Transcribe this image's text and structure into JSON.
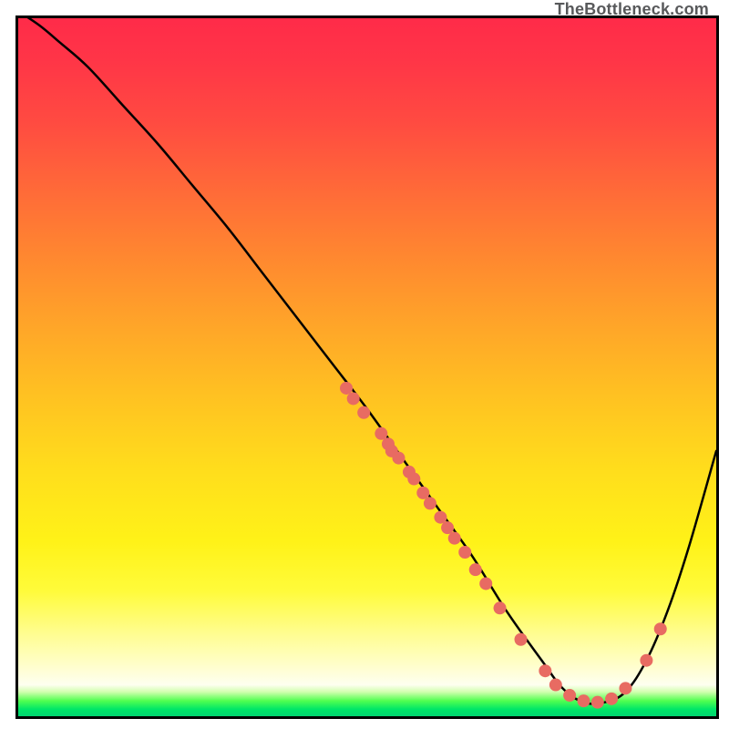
{
  "watermark": "TheBottleneck.com",
  "chart_data": {
    "type": "line",
    "title": "",
    "xlabel": "",
    "ylabel": "",
    "xlim": [
      0,
      100
    ],
    "ylim": [
      0,
      100
    ],
    "gradient_stops": [
      {
        "offset": 0.0,
        "color": "#ff2b49"
      },
      {
        "offset": 0.06,
        "color": "#ff3547"
      },
      {
        "offset": 0.15,
        "color": "#ff4b41"
      },
      {
        "offset": 0.25,
        "color": "#ff6b38"
      },
      {
        "offset": 0.35,
        "color": "#ff8a2f"
      },
      {
        "offset": 0.45,
        "color": "#ffa828"
      },
      {
        "offset": 0.55,
        "color": "#ffc421"
      },
      {
        "offset": 0.65,
        "color": "#ffde1c"
      },
      {
        "offset": 0.75,
        "color": "#fff218"
      },
      {
        "offset": 0.82,
        "color": "#fffb3a"
      },
      {
        "offset": 0.88,
        "color": "#fffd8e"
      },
      {
        "offset": 0.93,
        "color": "#fffecf"
      },
      {
        "offset": 0.955,
        "color": "#fefff0"
      },
      {
        "offset": 0.965,
        "color": "#d2ffb0"
      },
      {
        "offset": 0.978,
        "color": "#50ff50"
      },
      {
        "offset": 0.99,
        "color": "#00e668"
      },
      {
        "offset": 1.0,
        "color": "#00d570"
      }
    ],
    "series": [
      {
        "name": "curve",
        "x": [
          0.0,
          3.0,
          6.0,
          10.0,
          15.0,
          20.0,
          25.0,
          30.0,
          35.0,
          40.0,
          45.0,
          50.0,
          55.0,
          60.0,
          65.0,
          70.0,
          75.0,
          78.0,
          81.0,
          84.0,
          87.0,
          90.0,
          93.0,
          96.0,
          100.0
        ],
        "y": [
          101.0,
          99.0,
          96.5,
          93.0,
          87.5,
          82.0,
          76.0,
          70.0,
          63.5,
          57.0,
          50.5,
          44.0,
          37.0,
          30.0,
          23.0,
          15.0,
          8.0,
          4.0,
          2.0,
          2.0,
          3.5,
          8.0,
          15.0,
          24.0,
          38.0
        ]
      }
    ],
    "markers": {
      "name": "dots",
      "color": "#e86b62",
      "radius_px": 7,
      "points": [
        {
          "x": 47.0,
          "y": 47.0
        },
        {
          "x": 48.0,
          "y": 45.5
        },
        {
          "x": 49.5,
          "y": 43.5
        },
        {
          "x": 52.0,
          "y": 40.5
        },
        {
          "x": 53.0,
          "y": 39.0
        },
        {
          "x": 53.5,
          "y": 38.0
        },
        {
          "x": 54.5,
          "y": 37.0
        },
        {
          "x": 56.0,
          "y": 35.0
        },
        {
          "x": 56.7,
          "y": 34.0
        },
        {
          "x": 58.0,
          "y": 32.0
        },
        {
          "x": 59.0,
          "y": 30.5
        },
        {
          "x": 60.5,
          "y": 28.5
        },
        {
          "x": 61.5,
          "y": 27.0
        },
        {
          "x": 62.5,
          "y": 25.5
        },
        {
          "x": 64.0,
          "y": 23.5
        },
        {
          "x": 65.5,
          "y": 21.0
        },
        {
          "x": 67.0,
          "y": 19.0
        },
        {
          "x": 69.0,
          "y": 15.5
        },
        {
          "x": 72.0,
          "y": 11.0
        },
        {
          "x": 75.5,
          "y": 6.5
        },
        {
          "x": 77.0,
          "y": 4.5
        },
        {
          "x": 79.0,
          "y": 3.0
        },
        {
          "x": 81.0,
          "y": 2.2
        },
        {
          "x": 83.0,
          "y": 2.0
        },
        {
          "x": 85.0,
          "y": 2.5
        },
        {
          "x": 87.0,
          "y": 4.0
        },
        {
          "x": 90.0,
          "y": 8.0
        },
        {
          "x": 92.0,
          "y": 12.5
        }
      ]
    }
  }
}
